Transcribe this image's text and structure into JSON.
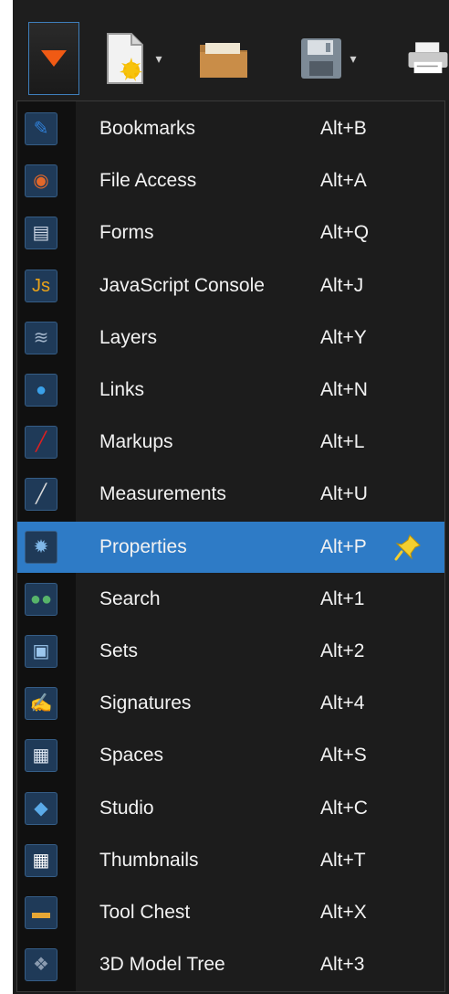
{
  "menu": {
    "items": [
      {
        "label": "Bookmarks",
        "shortcut": "Alt+B",
        "icon": "bookmark-icon",
        "glyph": "✎",
        "color": "#2f7fd6"
      },
      {
        "label": "File Access",
        "shortcut": "Alt+A",
        "icon": "file-access-icon",
        "glyph": "◉",
        "color": "#e2682a"
      },
      {
        "label": "Forms",
        "shortcut": "Alt+Q",
        "icon": "forms-icon",
        "glyph": "▤",
        "color": "#cfd8e6"
      },
      {
        "label": "JavaScript Console",
        "shortcut": "Alt+J",
        "icon": "javascript-icon",
        "glyph": "Js",
        "color": "#e8a21a"
      },
      {
        "label": "Layers",
        "shortcut": "Alt+Y",
        "icon": "layers-icon",
        "glyph": "≋",
        "color": "#9fb2c8"
      },
      {
        "label": "Links",
        "shortcut": "Alt+N",
        "icon": "links-icon",
        "glyph": "●",
        "color": "#3aa0e8"
      },
      {
        "label": "Markups",
        "shortcut": "Alt+L",
        "icon": "markups-icon",
        "glyph": "╱",
        "color": "#e01f1f"
      },
      {
        "label": "Measurements",
        "shortcut": "Alt+U",
        "icon": "measurements-icon",
        "glyph": "╱",
        "color": "#d9d9d9"
      },
      {
        "label": "Properties",
        "shortcut": "Alt+P",
        "icon": "properties-icon",
        "glyph": "✹",
        "color": "#7fb7e8"
      },
      {
        "label": "Search",
        "shortcut": "Alt+1",
        "icon": "search-icon",
        "glyph": "●●",
        "color": "#57b46a"
      },
      {
        "label": "Sets",
        "shortcut": "Alt+2",
        "icon": "sets-icon",
        "glyph": "▣",
        "color": "#9cc7ee"
      },
      {
        "label": "Signatures",
        "shortcut": "Alt+4",
        "icon": "signatures-icon",
        "glyph": "✍",
        "color": "#3d8fe0"
      },
      {
        "label": "Spaces",
        "shortcut": "Alt+S",
        "icon": "spaces-icon",
        "glyph": "▦",
        "color": "#dfe7f2"
      },
      {
        "label": "Studio",
        "shortcut": "Alt+C",
        "icon": "studio-icon",
        "glyph": "◆",
        "color": "#5aaae8"
      },
      {
        "label": "Thumbnails",
        "shortcut": "Alt+T",
        "icon": "thumbnails-icon",
        "glyph": "▦",
        "color": "#ffffff"
      },
      {
        "label": "Tool Chest",
        "shortcut": "Alt+X",
        "icon": "tool-chest-icon",
        "glyph": "▬",
        "color": "#e7a735"
      },
      {
        "label": "3D Model Tree",
        "shortcut": "Alt+3",
        "icon": "3d-model-tree-icon",
        "glyph": "❖",
        "color": "#8a9bb0"
      }
    ],
    "active_index": 8,
    "active_color": "#2e7bc6"
  },
  "toolbar": {
    "menu_button_icon": "triangle-down-icon",
    "new_icon": "new-document-icon",
    "open_icon": "folder-icon",
    "save_icon": "floppy-disk-icon",
    "print_icon": "printer-icon"
  }
}
